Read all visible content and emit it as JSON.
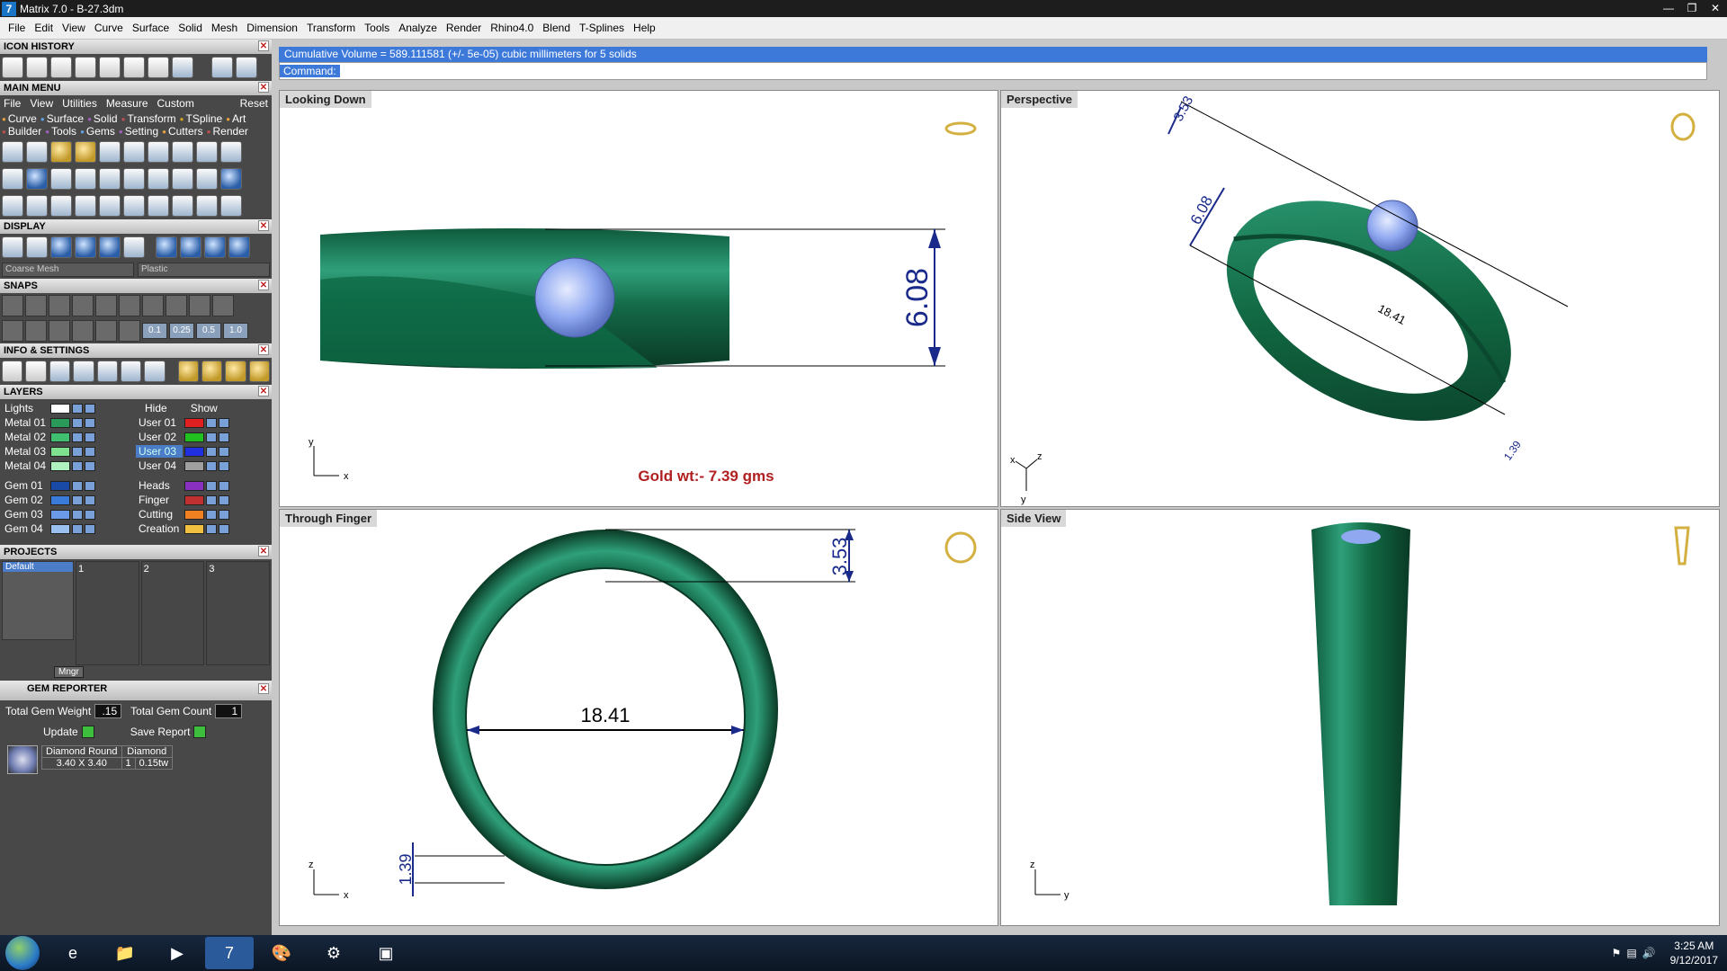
{
  "window": {
    "title": "Matrix 7.0 - B-27.3dm"
  },
  "menu": [
    "File",
    "Edit",
    "View",
    "Curve",
    "Surface",
    "Solid",
    "Mesh",
    "Dimension",
    "Transform",
    "Tools",
    "Analyze",
    "Render",
    "Rhino4.0",
    "Blend",
    "T-Splines",
    "Help"
  ],
  "panels": {
    "icon_history": "ICON HISTORY",
    "main_menu": "MAIN MENU",
    "main_tabs": [
      "File",
      "View",
      "Utilities",
      "Measure",
      "Custom"
    ],
    "reset": "Reset",
    "categories": [
      "Curve",
      "Surface",
      "Solid",
      "Transform",
      "TSpline",
      "Art",
      "Builder",
      "Tools",
      "Gems",
      "Setting",
      "Cutters",
      "Render"
    ],
    "display": "DISPLAY",
    "display_mode": "Coarse Mesh",
    "material": "Plastic",
    "snaps": "SNAPS",
    "snap_values": [
      "0.1",
      "0.25",
      "0.5",
      "1.0"
    ],
    "info": "INFO & SETTINGS",
    "layers": "LAYERS",
    "hide": "Hide",
    "show": "Show",
    "projects": "PROJECTS",
    "project_default": "Default",
    "project_slots": [
      "1",
      "2",
      "3"
    ],
    "mngr": "Mngr"
  },
  "layers": {
    "left": [
      {
        "name": "Lights",
        "color": "#ffffff"
      },
      {
        "name": "Metal 01",
        "color": "#2a9a5a"
      },
      {
        "name": "Metal 02",
        "color": "#3fbf6f"
      },
      {
        "name": "Metal 03",
        "color": "#7fe08f"
      },
      {
        "name": "Metal 04",
        "color": "#aef0bf"
      },
      {
        "name": "Gem 01",
        "color": "#1a4aa8"
      },
      {
        "name": "Gem 02",
        "color": "#3a7ad8"
      },
      {
        "name": "Gem 03",
        "color": "#6a9ae8"
      },
      {
        "name": "Gem 04",
        "color": "#9ac0f0"
      }
    ],
    "right": [
      {
        "name": "User 01",
        "color": "#e02020"
      },
      {
        "name": "User 02",
        "color": "#20c020"
      },
      {
        "name": "User 03",
        "color": "#2030e0"
      },
      {
        "name": "User 04",
        "color": "#a0a0a0"
      },
      {
        "name": "Heads",
        "color": "#8a30c0"
      },
      {
        "name": "Finger",
        "color": "#c03030"
      },
      {
        "name": "Cutting",
        "color": "#f08020"
      },
      {
        "name": "Creation",
        "color": "#f0c040"
      }
    ]
  },
  "gem_reporter": {
    "title": "GEM REPORTER",
    "total_weight_label": "Total Gem Weight",
    "total_weight": ".15",
    "total_count_label": "Total Gem Count",
    "total_count": "1",
    "update": "Update",
    "save_report": "Save Report",
    "row": {
      "shape": "Diamond Round",
      "type": "Diamond",
      "size": "3.40 X 3.40",
      "qty": "1",
      "wt": "0.15tw"
    }
  },
  "command": {
    "status": "Cumulative Volume = 589.111581 (+/- 5e-05) cubic millimeters for 5 solids",
    "label": "Command:"
  },
  "viewports": {
    "top_left": {
      "title": "Looking Down",
      "dim": "6.08",
      "note": "Gold wt:- 7.39 gms",
      "axis_x": "x",
      "axis_y": "y"
    },
    "top_right": {
      "title": "Perspective",
      "dim1": "3.53",
      "dim2": "6.08",
      "dim3": "18.41",
      "dim4": "1.39",
      "axis_x": "x",
      "axis_y": "y",
      "axis_z": "z"
    },
    "bottom_left": {
      "title": "Through Finger",
      "dim1": "3.53",
      "dim2": "18.41",
      "dim3": "1.39",
      "axis_x": "x",
      "axis_z": "z"
    },
    "bottom_right": {
      "title": "Side View",
      "axis_y": "y",
      "axis_z": "z"
    }
  },
  "taskbar": {
    "time": "3:25 AM",
    "date": "9/12/2017"
  },
  "colors": {
    "metal": "#1f8a5e",
    "metal_dark": "#0e4a32",
    "gem": "#8fa8f0",
    "dim": "#1a2a8a",
    "note": "#b02020",
    "accent": "#3d79d9"
  }
}
